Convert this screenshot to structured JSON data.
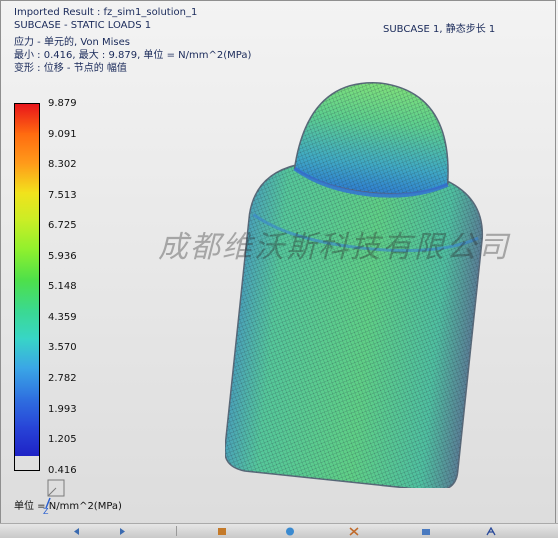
{
  "header": {
    "result_title": "Imported Result : fz_sim1_solution_1",
    "subcase": "SUBCASE - STATIC LOADS 1",
    "stress_line": "应力 - 单元的, Von Mises",
    "minmax_line": "最小 : 0.416, 最大 : 9.879, 单位 = N/mm^2(MPa)",
    "deform_line": "变形 : 位移 - 节点的 幅值",
    "subcase_step": "SUBCASE 1, 静态步长 1"
  },
  "legend": {
    "ticks": [
      "9.879",
      "9.091",
      "8.302",
      "7.513",
      "6.725",
      "5.936",
      "5.148",
      "4.359",
      "3.570",
      "2.782",
      "1.993",
      "1.205",
      "0.416"
    ],
    "colors": [
      "#e8151b",
      "#ff6a10",
      "#ff9a1a",
      "#f2e21c",
      "#c8ee26",
      "#8ef02e",
      "#4ee04a",
      "#3bd98e",
      "#38d6c6",
      "#3aa6e6",
      "#2f72e0",
      "#2846d8",
      "#1e22c6"
    ]
  },
  "unit_label": "单位 = N/mm^2(MPa)",
  "watermark": "成都维沃斯科技有限公司",
  "triad": {
    "axis_z": "Z"
  },
  "toolbar_icons": [
    "arrow-left-icon",
    "arrow-right-icon",
    "view-icon",
    "sphere-icon",
    "tools-icon",
    "edit-icon",
    "text-a-icon"
  ]
}
